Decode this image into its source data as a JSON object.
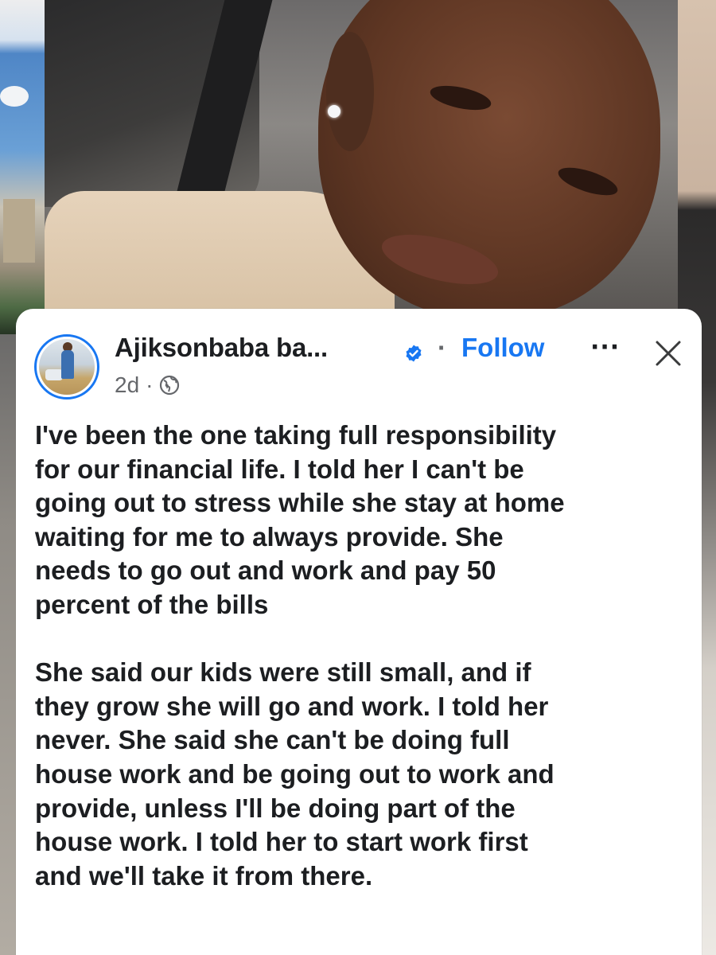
{
  "post": {
    "author_name": "Ajiksonbaba ba...",
    "separator": "·",
    "follow_label": "Follow",
    "more_label": "···",
    "timestamp": "2d",
    "meta_separator": "·",
    "icons": {
      "verified": "verified-badge-icon",
      "audience": "globe-icon",
      "close": "close-icon",
      "more": "more-options-icon"
    },
    "paragraphs": [
      "I've been the one taking full responsibility\nfor our financial life. I told her I can't be\ngoing out to stress while she stay at home\nwaiting for me to always provide. She\nneeds to go out and work and pay 50\npercent of the bills",
      "She said our kids were still small, and if\nthey grow she will go and work. I told her\nnever. She said she can't be doing full\nhouse work and be going out to work and\nprovide, unless I'll be doing part of the\nhouse work. I told her to start work first\nand we'll take it from there."
    ]
  },
  "colors": {
    "accent": "#1877f2",
    "text": "#1c1e21",
    "secondary_text": "#65676b",
    "card_background": "#ffffff"
  }
}
